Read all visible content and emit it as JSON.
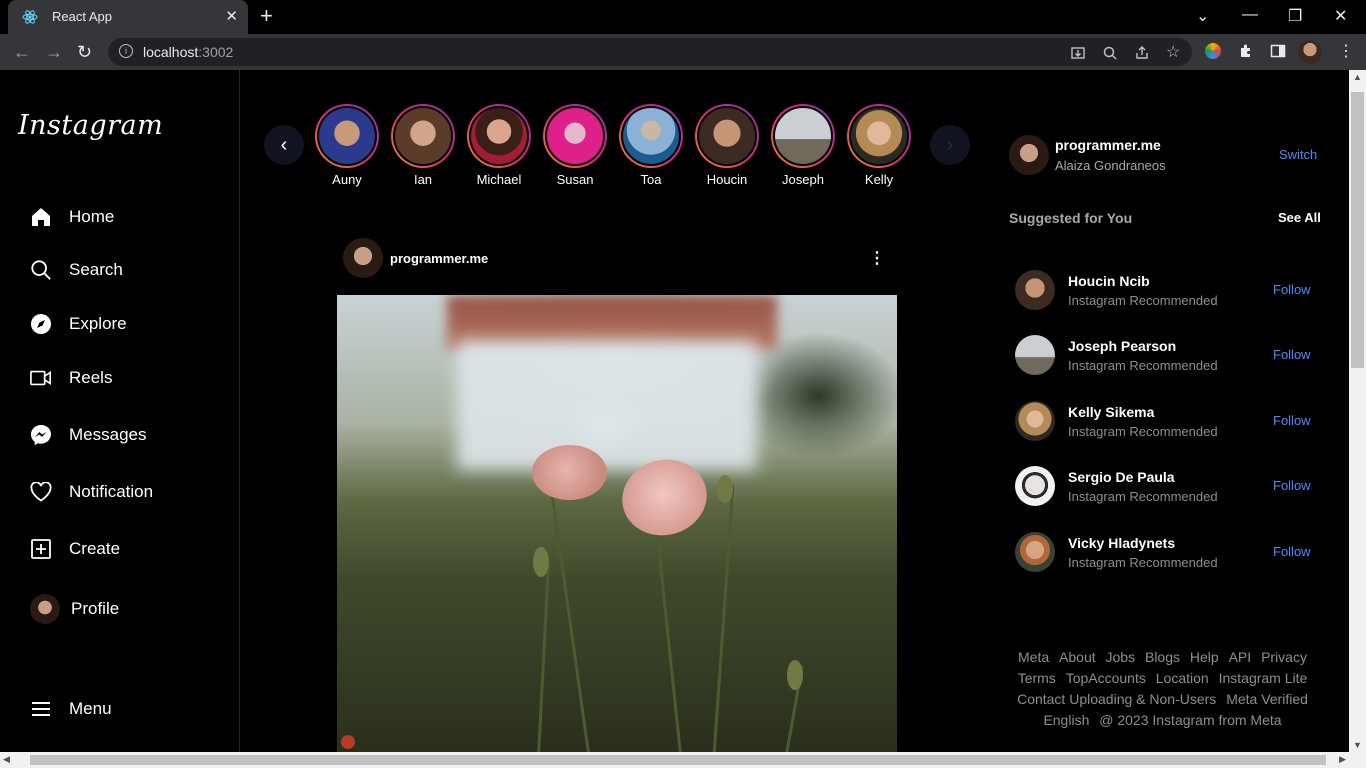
{
  "browser": {
    "tab_title": "React App",
    "url_host": "localhost",
    "url_port": ":3002"
  },
  "sidebar": {
    "logo": "Instagram",
    "items": [
      {
        "label": "Home",
        "icon": "home-icon"
      },
      {
        "label": "Search",
        "icon": "search-icon"
      },
      {
        "label": "Explore",
        "icon": "compass-icon"
      },
      {
        "label": "Reels",
        "icon": "video-icon"
      },
      {
        "label": "Messages",
        "icon": "messenger-icon"
      },
      {
        "label": "Notification",
        "icon": "heart-icon"
      },
      {
        "label": "Create",
        "icon": "plus-square-icon"
      },
      {
        "label": "Profile",
        "icon": "avatar"
      }
    ],
    "menu_label": "Menu"
  },
  "stories": [
    "Auny",
    "Ian",
    "Michael",
    "Susan",
    "Toa",
    "Houcin",
    "Joseph",
    "Kelly"
  ],
  "post": {
    "username": "programmer.me"
  },
  "account": {
    "username": "programmer.me",
    "name": "Alaiza Gondraneos",
    "switch_label": "Switch"
  },
  "suggestions": {
    "heading": "Suggested for You",
    "see_all": "See All",
    "follow_label": "Follow",
    "items": [
      {
        "name": "Houcin Ncib",
        "sub": "Instagram Recommended"
      },
      {
        "name": "Joseph Pearson",
        "sub": "Instagram Recommended"
      },
      {
        "name": "Kelly Sikema",
        "sub": "Instagram Recommended"
      },
      {
        "name": "Sergio De Paula",
        "sub": "Instagram Recommended"
      },
      {
        "name": "Vicky Hladynets",
        "sub": "Instagram Recommended"
      }
    ]
  },
  "footer": {
    "line1": [
      "Meta",
      "About",
      "Jobs",
      "Blogs",
      "Help",
      "API",
      "Privacy"
    ],
    "line2": [
      "Terms",
      "TopAccounts",
      "Location",
      "Instagram Lite"
    ],
    "line3": [
      "Contact Uploading & Non-Users",
      "Meta Verified"
    ],
    "line4": [
      "English",
      "@ 2023 Instagram from Meta"
    ]
  },
  "colors": {
    "accent": "#4f8bf7",
    "background": "#000000",
    "story_ring": "#dd2a7b"
  }
}
